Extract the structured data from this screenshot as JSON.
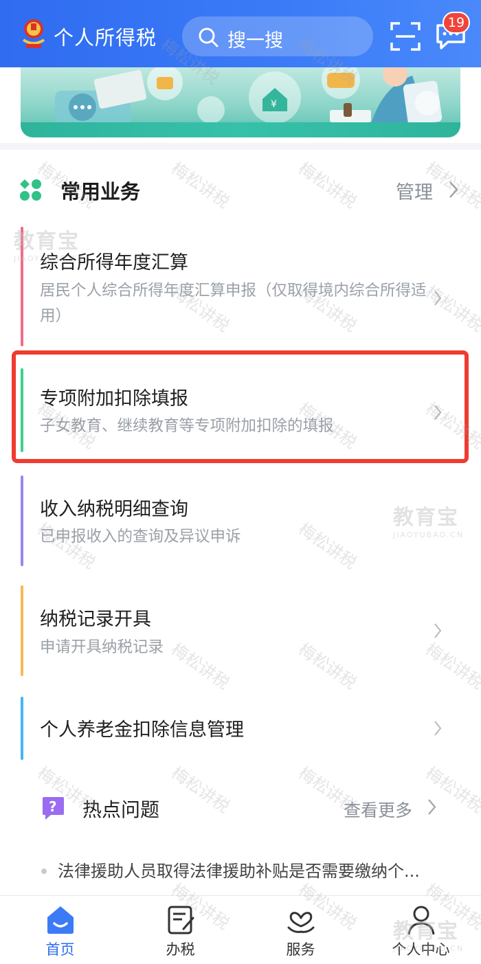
{
  "header": {
    "app_title": "个人所得税",
    "search_placeholder": "搜一搜",
    "message_badge": "19"
  },
  "common_business": {
    "title": "常用业务",
    "manage_label": "管理",
    "items": [
      {
        "title": "综合所得年度汇算",
        "description": "居民个人综合所得年度汇算申报（仅取得境内综合所得适用）",
        "accent": "#f06c8a"
      },
      {
        "title": "专项附加扣除填报",
        "description": "子女教育、继续教育等专项附加扣除的填报",
        "accent": "#3fcf8e"
      },
      {
        "title": "收入纳税明细查询",
        "description": "已申报收入的查询及异议申诉",
        "accent": "#9b86f0"
      },
      {
        "title": "纳税记录开具",
        "description": "申请开具纳税记录",
        "accent": "#f7b955"
      },
      {
        "title": "个人养老金扣除信息管理",
        "description": "",
        "accent": "#43b6f5"
      }
    ]
  },
  "hot_questions": {
    "title": "热点问题",
    "more_label": "查看更多",
    "items": [
      "法律援助人员取得法律援助补贴是否需要缴纳个..."
    ]
  },
  "bottom_nav": {
    "items": [
      {
        "label": "首页",
        "icon": "home-icon",
        "active": true
      },
      {
        "label": "办税",
        "icon": "tax-form-icon",
        "active": false
      },
      {
        "label": "服务",
        "icon": "service-heart-icon",
        "active": false
      },
      {
        "label": "个人中心",
        "icon": "profile-icon",
        "active": false
      }
    ]
  },
  "watermarks": {
    "diagonal_text": "梅松讲税",
    "logo_text": "教育宝",
    "logo_url_text": "JIAOYUBAO.CN"
  },
  "colors": {
    "header_blue": "#2f6cf0",
    "highlight_red": "#ef3b30",
    "badge_red": "#f0443a"
  }
}
